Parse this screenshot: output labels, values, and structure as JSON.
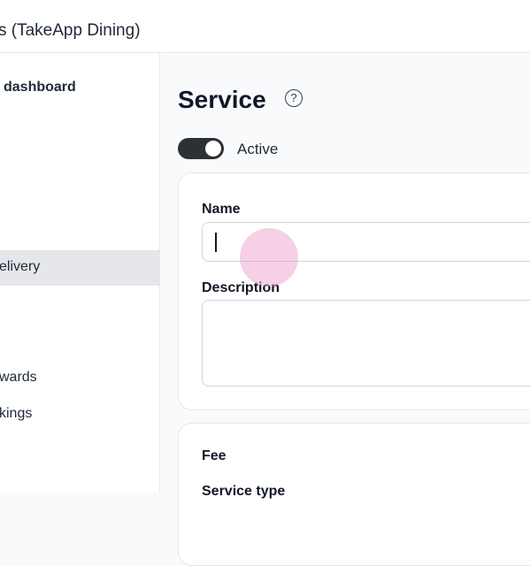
{
  "window": {
    "title": "s (TakeApp Dining)"
  },
  "sidebar": {
    "items": [
      {
        "label": "dashboard"
      },
      {
        "label": "elivery"
      },
      {
        "label": "wards"
      },
      {
        "label": "kings"
      }
    ]
  },
  "page": {
    "title": "Service",
    "help_glyph": "?",
    "active_toggle": {
      "label": "Active",
      "on": true
    }
  },
  "form": {
    "name": {
      "label": "Name",
      "value": "",
      "placeholder": ""
    },
    "description": {
      "label": "Description",
      "value": "",
      "placeholder": ""
    }
  },
  "fee_card": {
    "title": "Fee",
    "service_type_label": "Service type"
  },
  "colors": {
    "toggle_on": "#2d3035",
    "tap_indicator": "#ec96c3",
    "active_nav_bg": "#e5e7eb"
  }
}
